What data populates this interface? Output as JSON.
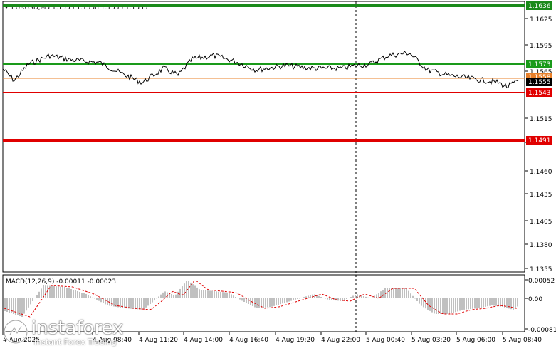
{
  "header": {
    "symbol_line": "EURUSD,M5  1.1555 1.1558 1.1555 1.1555"
  },
  "price_axis": {
    "ticks": [
      "1.1625",
      "1.1595",
      "1.1565",
      "1.1515",
      "1.1490",
      "1.1460",
      "1.1435",
      "1.1405",
      "1.1380",
      "1.1355"
    ]
  },
  "levels": [
    {
      "label": "1.1636",
      "color": "#1a8a1a",
      "kind": "green"
    },
    {
      "label": "1.1573",
      "color": "#1a9a1a",
      "kind": "green"
    },
    {
      "label": "1.1558",
      "color": "#e8802a",
      "kind": "orange"
    },
    {
      "label": "1.1555",
      "color": "#000000",
      "kind": "current"
    },
    {
      "label": "1.1543",
      "color": "#e00000",
      "kind": "red"
    },
    {
      "label": "1.1491",
      "color": "#e00000",
      "kind": "red"
    }
  ],
  "macd": {
    "label": "MACD(12,26,9) -0.00011 -0.00023",
    "ticks": [
      "0.00052",
      "0.00",
      "-0.00081"
    ]
  },
  "time_axis": {
    "labels": [
      "4 Aug 2025",
      "4 Aug 08:40",
      "4 Aug 11:20",
      "4 Aug 14:00",
      "4 Aug 16:40",
      "4 Aug 19:20",
      "4 Aug 22:00",
      "5 Aug 00:40",
      "5 Aug 03:20",
      "5 Aug 06:00",
      "5 Aug 08:40"
    ]
  },
  "watermark": {
    "name": "instaforex",
    "tagline": "Instant Forex Trading"
  },
  "colors": {
    "background": "#ffffff",
    "price_line": "#000000",
    "green_level": "#1a8a1a",
    "red_level": "#e00000",
    "histogram": "#c0c0c0",
    "signal": "#e00000"
  }
}
